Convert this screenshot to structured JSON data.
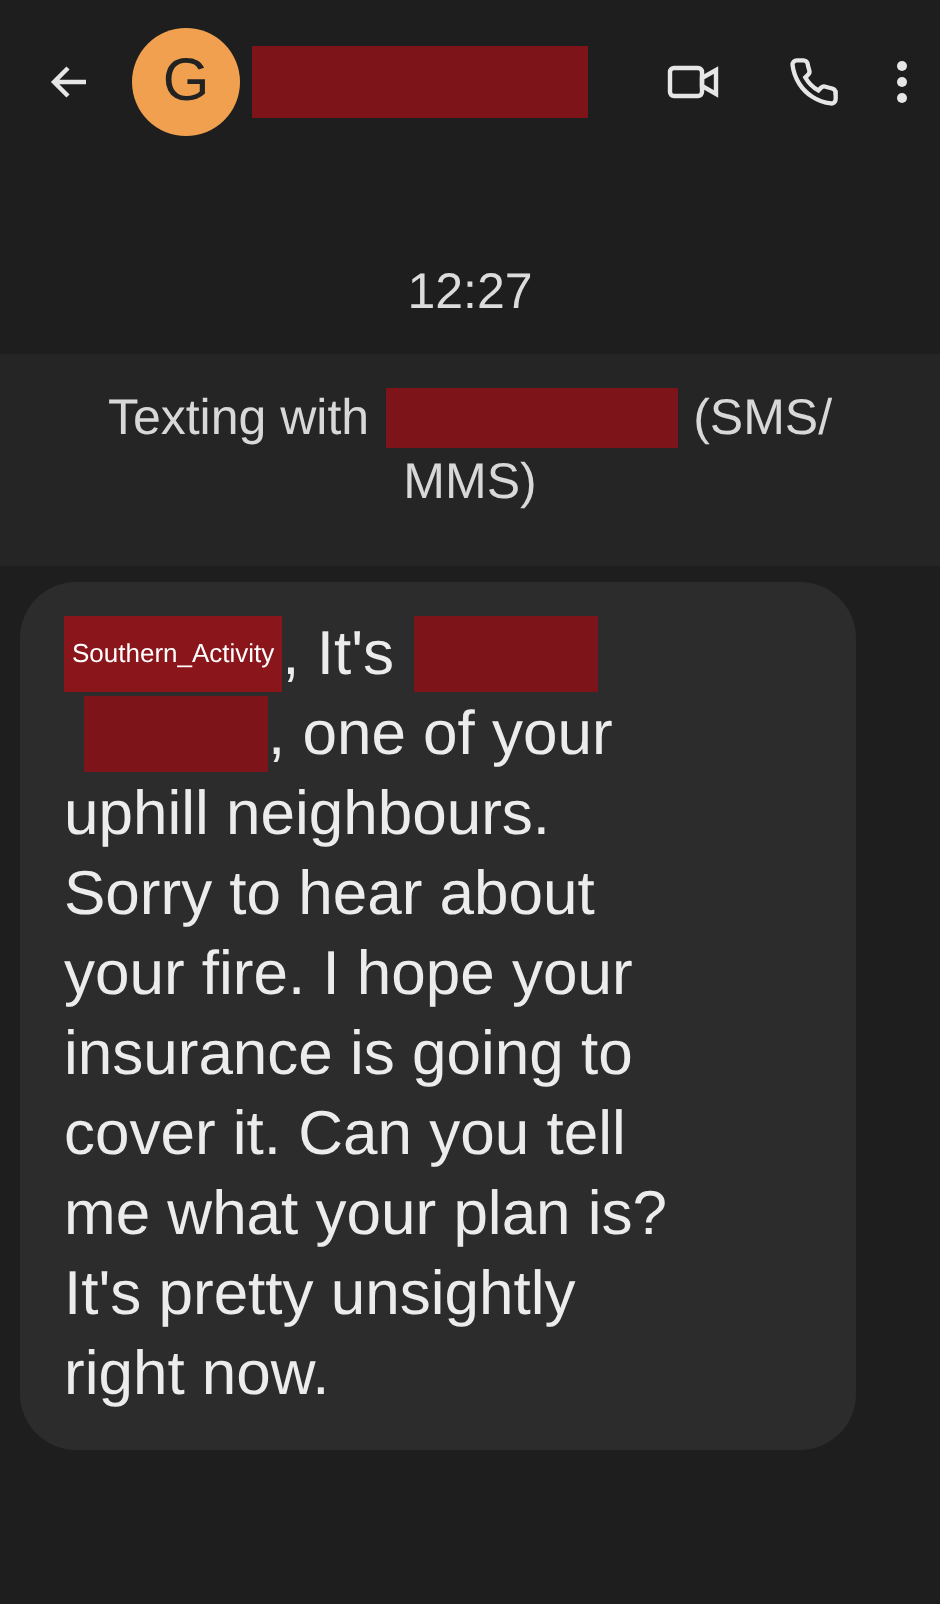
{
  "header": {
    "avatar_letter": "G",
    "name_redacted": true
  },
  "time": "12:27",
  "banner": {
    "lines": [
      [
        {
          "kind": "text",
          "text": "Texting with"
        },
        {
          "kind": "redaction"
        },
        {
          "kind": "text",
          "text": "(SMS/"
        }
      ],
      [
        {
          "kind": "text",
          "text": "MMS)"
        }
      ]
    ]
  },
  "message": {
    "lines": [
      [
        {
          "kind": "tag",
          "text": "Southern_Activity"
        },
        {
          "kind": "text",
          "text": ", It's"
        },
        {
          "kind": "redaction"
        }
      ],
      [
        {
          "kind": "redaction"
        },
        {
          "kind": "text",
          "text": ", one of your"
        }
      ],
      [
        {
          "kind": "text",
          "text": "uphill neighbours."
        }
      ],
      [
        {
          "kind": "text",
          "text": "Sorry to hear about"
        }
      ],
      [
        {
          "kind": "text",
          "text": "your fire. I hope your"
        }
      ],
      [
        {
          "kind": "text",
          "text": "insurance is going to"
        }
      ],
      [
        {
          "kind": "text",
          "text": "cover it. Can you tell"
        }
      ],
      [
        {
          "kind": "text",
          "text": "me what your plan is?"
        }
      ],
      [
        {
          "kind": "text",
          "text": "It's pretty unsightly"
        }
      ],
      [
        {
          "kind": "text",
          "text": "right now."
        }
      ]
    ]
  }
}
